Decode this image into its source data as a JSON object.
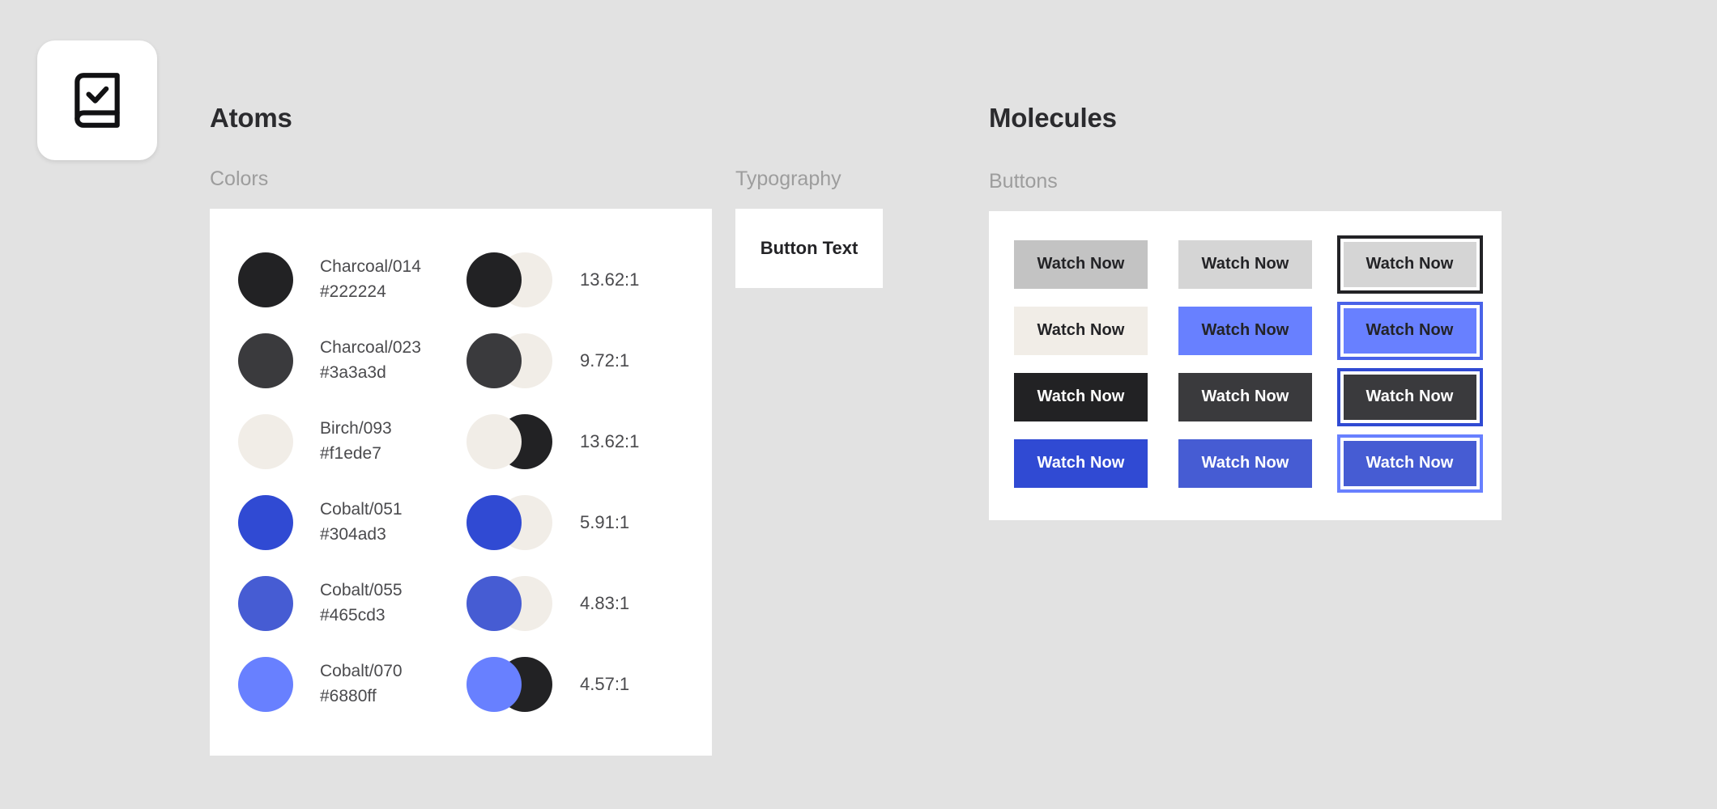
{
  "app": {
    "logo_icon": "book-check-icon",
    "canvas_background": "#e2e2e2"
  },
  "sections": {
    "atoms": {
      "title": "Atoms",
      "groups": {
        "colors": {
          "label": "Colors",
          "rows": [
            {
              "name": "Charcoal/014",
              "hex": "#222224",
              "ratio": "13.62:1",
              "pair_front": "#222224",
              "pair_back": "#f1ede7"
            },
            {
              "name": "Charcoal/023",
              "hex": "#3a3a3d",
              "ratio": "9.72:1",
              "pair_front": "#3a3a3d",
              "pair_back": "#f1ede7"
            },
            {
              "name": "Birch/093",
              "hex": "#f1ede7",
              "ratio": "13.62:1",
              "pair_front": "#f1ede7",
              "pair_back": "#222224"
            },
            {
              "name": "Cobalt/051",
              "hex": "#304ad3",
              "ratio": "5.91:1",
              "pair_front": "#304ad3",
              "pair_back": "#f1ede7"
            },
            {
              "name": "Cobalt/055",
              "hex": "#465cd3",
              "ratio": "4.83:1",
              "pair_front": "#465cd3",
              "pair_back": "#f1ede7"
            },
            {
              "name": "Cobalt/070",
              "hex": "#6880ff",
              "ratio": "4.57:1",
              "pair_front": "#6880ff",
              "pair_back": "#222224"
            }
          ]
        },
        "typography": {
          "label": "Typography",
          "sample_text": "Button Text"
        }
      }
    },
    "molecules": {
      "title": "Molecules",
      "groups": {
        "buttons": {
          "label": "Buttons",
          "items": [
            {
              "label": "Watch Now",
              "bg": "#c3c3c3",
              "fg": "#232326",
              "focus_ring": null
            },
            {
              "label": "Watch Now",
              "bg": "#d5d5d5",
              "fg": "#232326",
              "focus_ring": null
            },
            {
              "label": "Watch Now",
              "bg": "#d5d5d5",
              "fg": "#232326",
              "focus_ring": "#232326"
            },
            {
              "label": "Watch Now",
              "bg": "#f1ede7",
              "fg": "#232326",
              "focus_ring": null
            },
            {
              "label": "Watch Now",
              "bg": "#6880ff",
              "fg": "#232326",
              "focus_ring": null
            },
            {
              "label": "Watch Now",
              "bg": "#6880ff",
              "fg": "#232326",
              "focus_ring": "#4a63e8"
            },
            {
              "label": "Watch Now",
              "bg": "#222224",
              "fg": "#ffffff",
              "focus_ring": null
            },
            {
              "label": "Watch Now",
              "bg": "#3a3a3d",
              "fg": "#ffffff",
              "focus_ring": null
            },
            {
              "label": "Watch Now",
              "bg": "#3a3a3d",
              "fg": "#ffffff",
              "focus_ring": "#304ad3"
            },
            {
              "label": "Watch Now",
              "bg": "#304ad3",
              "fg": "#ffffff",
              "focus_ring": null
            },
            {
              "label": "Watch Now",
              "bg": "#465cd3",
              "fg": "#ffffff",
              "focus_ring": null
            },
            {
              "label": "Watch Now",
              "bg": "#465cd3",
              "fg": "#ffffff",
              "focus_ring": "#6880ff"
            }
          ]
        }
      }
    }
  }
}
